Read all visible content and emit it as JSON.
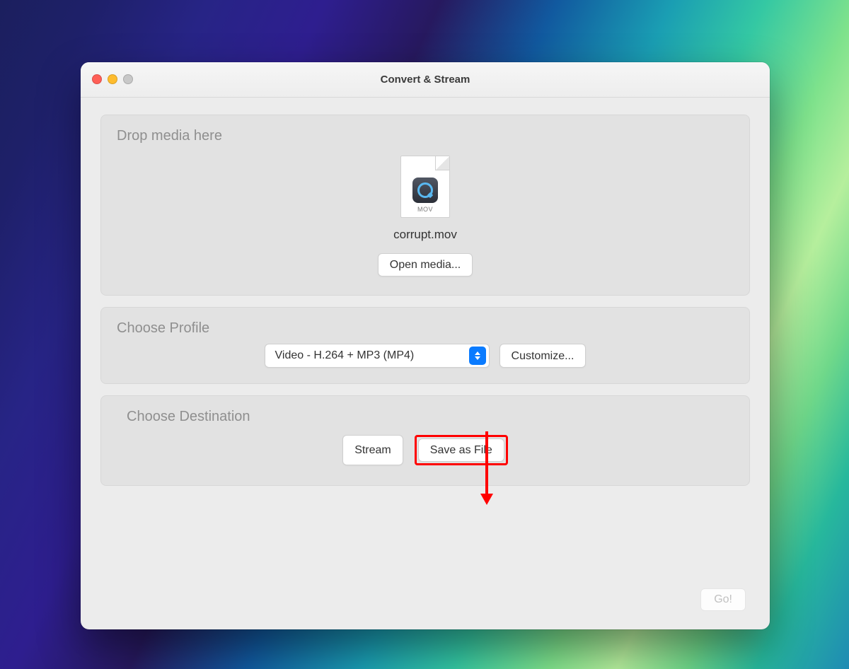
{
  "window": {
    "title": "Convert & Stream"
  },
  "drop": {
    "heading": "Drop media here",
    "file_ext": "MOV",
    "file_name": "corrupt.mov",
    "open_media_label": "Open media..."
  },
  "profile": {
    "heading": "Choose Profile",
    "selected": "Video - H.264 + MP3 (MP4)",
    "customize_label": "Customize..."
  },
  "destination": {
    "heading": "Choose Destination",
    "stream_label": "Stream",
    "save_label": "Save as File"
  },
  "footer": {
    "go_label": "Go!"
  },
  "annotation": {
    "target": "save-as-file-button",
    "color": "#ff0000"
  }
}
